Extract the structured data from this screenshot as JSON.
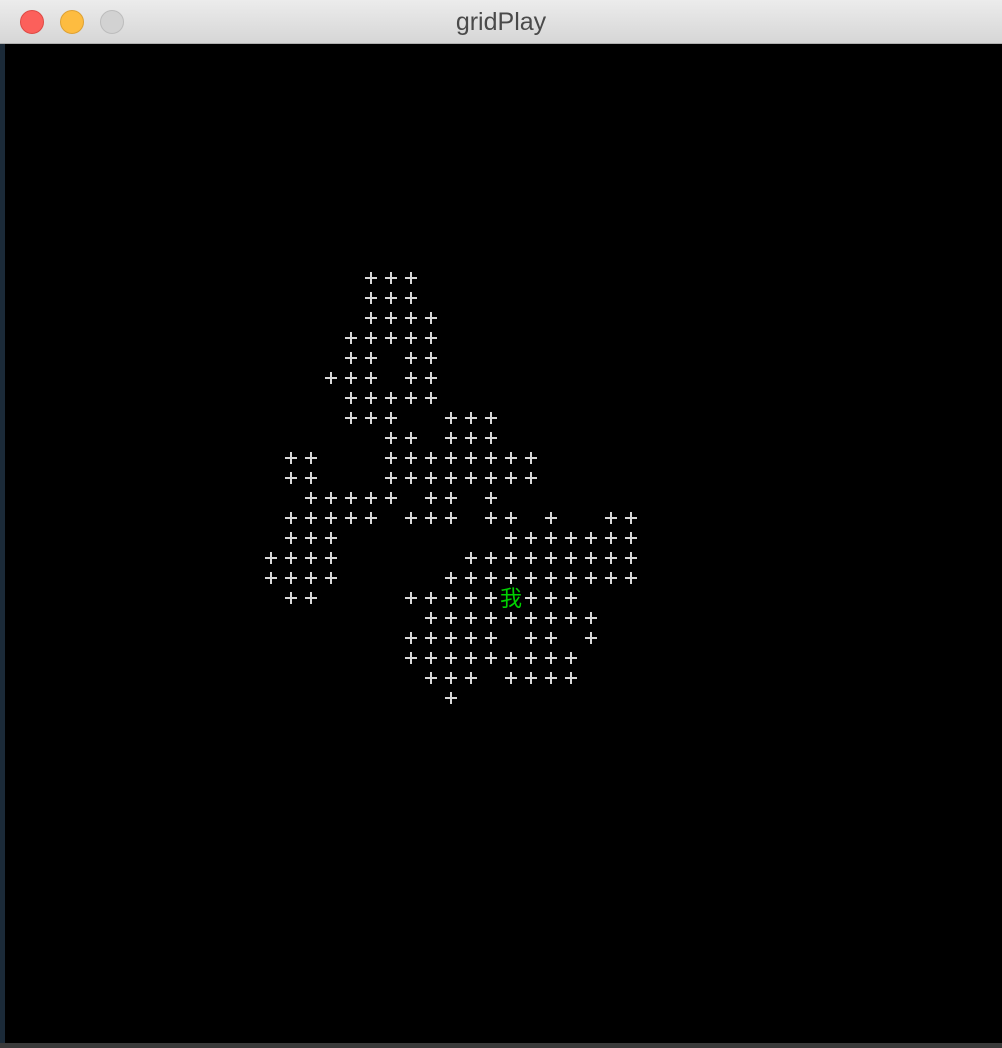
{
  "window": {
    "title": "gridPlay"
  },
  "colors": {
    "background": "#000000",
    "tile": "#d8d8d8",
    "player": "#00d000"
  },
  "grid": {
    "tile_glyph": "+",
    "player_glyph": "我",
    "player": {
      "row": 16,
      "col": 12
    },
    "rows": [
      "00000000000000000000000000000000000000000000000000",
      "00000000000000000000000000000000000000000000000000",
      "00000000000000000000000000000000000000000000000000",
      "00000000000000000000000000000000000000000000000000",
      "00000000000000000000000000000000000000000000000000",
      "00000000000000000000000000000000000000000000000000",
      "00000000000000000000000000000000000000000000000000",
      "00000000000000000000000000000000000000000000000000",
      "00000000000000000000000000000000000000000000000000",
      "00000000000000000000000000000000000000000000000000",
      "00000000000000000000000000000000000000000000000000",
      "00000000000000000000000000000000000000000000000000",
      "00000000000000000000000000000000000000000000000000",
      "00000000000000000000000000000000000000000000000000"
    ],
    "tiles": [
      {
        "row": 0,
        "cols": [
          5,
          6,
          7
        ]
      },
      {
        "row": 1,
        "cols": [
          5,
          6,
          7
        ]
      },
      {
        "row": 2,
        "cols": [
          5,
          6,
          7,
          8
        ]
      },
      {
        "row": 3,
        "cols": [
          4,
          5,
          6,
          7,
          8
        ]
      },
      {
        "row": 4,
        "cols": [
          4,
          5,
          7,
          8
        ]
      },
      {
        "row": 5,
        "cols": [
          3,
          4,
          5,
          7,
          8
        ]
      },
      {
        "row": 6,
        "cols": [
          4,
          5,
          6,
          7,
          8
        ]
      },
      {
        "row": 7,
        "cols": [
          4,
          5,
          6,
          9,
          10,
          11
        ]
      },
      {
        "row": 8,
        "cols": [
          6,
          7,
          9,
          10,
          11
        ]
      },
      {
        "row": 9,
        "cols": [
          1,
          2,
          6,
          7,
          8,
          9,
          10,
          11,
          12,
          13
        ]
      },
      {
        "row": 10,
        "cols": [
          1,
          2,
          6,
          7,
          8,
          9,
          10,
          11,
          12,
          13
        ]
      },
      {
        "row": 11,
        "cols": [
          2,
          3,
          4,
          5,
          6,
          8,
          9,
          11
        ]
      },
      {
        "row": 12,
        "cols": [
          1,
          2,
          3,
          4,
          5,
          7,
          8,
          9,
          11,
          12,
          14,
          17,
          18
        ]
      },
      {
        "row": 13,
        "cols": [
          1,
          2,
          3,
          12,
          13,
          14,
          15,
          16,
          17,
          18
        ]
      },
      {
        "row": 14,
        "cols": [
          0,
          1,
          2,
          3,
          10,
          11,
          12,
          13,
          14,
          15,
          16,
          17,
          18
        ]
      },
      {
        "row": 15,
        "cols": [
          0,
          1,
          2,
          3,
          9,
          10,
          11,
          12,
          13,
          14,
          15,
          16,
          17,
          18
        ]
      },
      {
        "row": 16,
        "cols": [
          1,
          2,
          7,
          8,
          9,
          10,
          11,
          13,
          14,
          15
        ]
      },
      {
        "row": 17,
        "cols": [
          8,
          9,
          10,
          11,
          12,
          13,
          14,
          15,
          16
        ]
      },
      {
        "row": 18,
        "cols": [
          7,
          8,
          9,
          10,
          11,
          13,
          14,
          16
        ]
      },
      {
        "row": 19,
        "cols": [
          7,
          8,
          9,
          10,
          11,
          12,
          13,
          14,
          15
        ]
      },
      {
        "row": 20,
        "cols": [
          8,
          9,
          10,
          12,
          13,
          14,
          15
        ]
      },
      {
        "row": 21,
        "cols": [
          9
        ]
      }
    ]
  }
}
